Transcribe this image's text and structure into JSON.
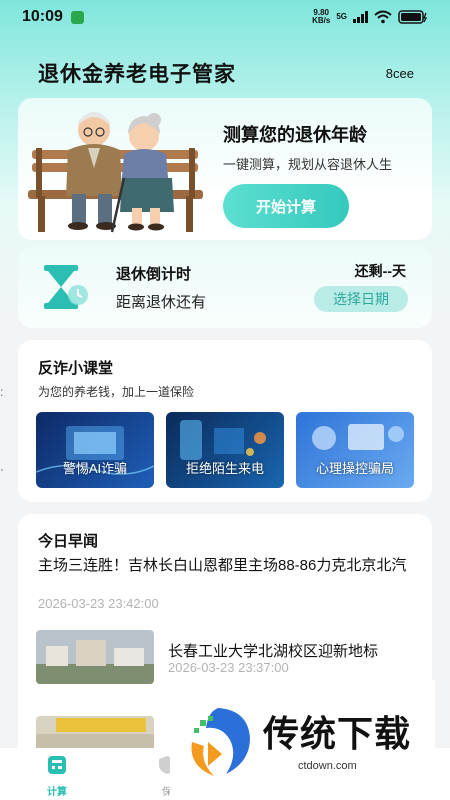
{
  "status_bar": {
    "time": "10:09",
    "net_speed": "9.80",
    "net_unit": "KB/s",
    "network": "5G"
  },
  "header": {
    "title": "退休金养老电子管家",
    "code": "8cee"
  },
  "calc_card": {
    "title": "测算您的退休年龄",
    "subtitle": "一键测算，规划从容退休人生",
    "button": "开始计算"
  },
  "countdown": {
    "title": "退休倒计时",
    "subtitle": "距离退休还有",
    "remaining": "还剩--天",
    "button": "选择日期"
  },
  "fraud": {
    "title": "反诈小课堂",
    "subtitle": "为您的养老钱，加上一道保险",
    "tiles": [
      {
        "label": "警惕AI诈骗"
      },
      {
        "label": "拒绝陌生来电"
      },
      {
        "label": "心理操控骗局"
      }
    ]
  },
  "news": {
    "title": "今日早闻",
    "items": [
      {
        "headline": "主场三连胜！吉林长白山恩都里主场88-86力克北京北汽",
        "time": "2026-03-23 23:42:00"
      },
      {
        "headline": "长春工业大学北湖校区迎新地标",
        "time": "2026-03-23 23:37:00"
      }
    ]
  },
  "tabbar": {
    "tabs": [
      {
        "label": "计算"
      },
      {
        "label": "保"
      }
    ]
  },
  "watermark": {
    "text": "传统下载",
    "url": "ctdown.com"
  },
  "colors": {
    "accent": "#34c9bd",
    "accent_light": "#b9ece6",
    "time_gray": "#b4b4b4"
  }
}
